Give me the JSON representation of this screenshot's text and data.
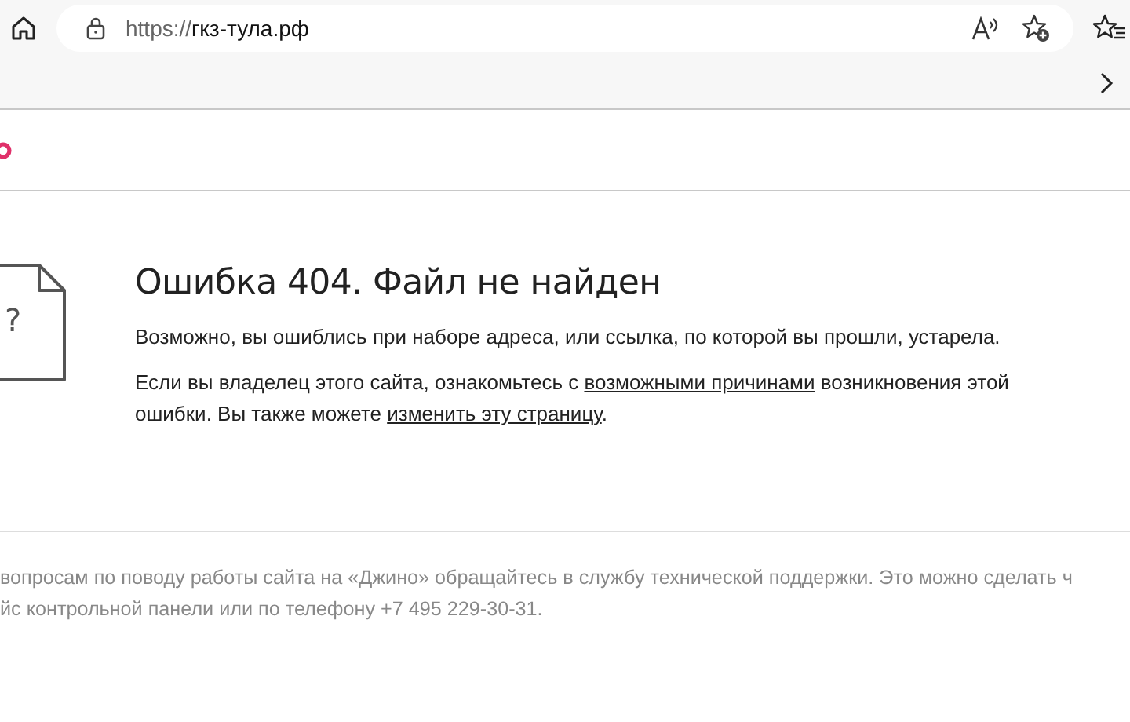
{
  "browser": {
    "url_scheme": "https://",
    "url_host": "гкз-тула.рф"
  },
  "error": {
    "title": "Ошибка 404. Файл не найден",
    "icon_text": "?",
    "paragraphs": [
      [
        {
          "text": "Возможно, вы ошиблись при наборе адреса, или ссылка, по которой вы прошли, устарела.",
          "link": false
        }
      ],
      [
        {
          "text": "Если вы владелец этого сайта, ознакомьтесь с ",
          "link": false
        },
        {
          "text": "возможными причинами",
          "link": true
        },
        {
          "text": " возникновения этой ошибки. Вы также можете ",
          "link": false
        },
        {
          "text": "изменить эту страницу",
          "link": true
        },
        {
          "text": ".",
          "link": false
        }
      ]
    ]
  },
  "footer": {
    "lines": [
      "вопросам по поводу работы сайта на «Джино» обращайтесь в службу технической поддержки. Это можно сделать ч",
      "йс контрольной панели или по телефону +7 495 229-30-31."
    ]
  }
}
